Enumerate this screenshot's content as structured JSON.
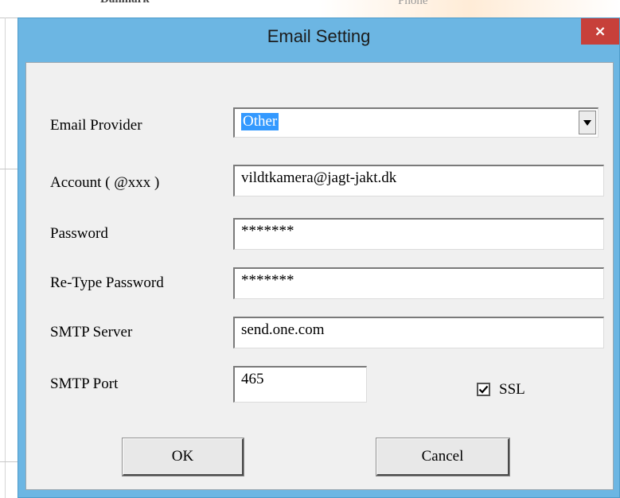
{
  "background": {
    "partial_text_1": "Danmark",
    "partial_text_2": "Phone"
  },
  "dialog": {
    "title": "Email Setting",
    "close_icon": "×",
    "accent_color": "#6cb6e3",
    "close_color": "#c7403a",
    "fields": {
      "provider": {
        "label": "Email Provider",
        "value": "Other"
      },
      "account": {
        "label": "Account ( @xxx )",
        "value": "vildtkamera@jagt-jakt.dk"
      },
      "password": {
        "label": "Password",
        "value": "*******"
      },
      "retype": {
        "label": "Re-Type Password",
        "value": "*******"
      },
      "server": {
        "label": "SMTP Server",
        "value": "send.one.com"
      },
      "port": {
        "label": "SMTP Port",
        "value": "465"
      }
    },
    "ssl": {
      "label": "SSL",
      "checked": true
    },
    "buttons": {
      "ok": "OK",
      "cancel": "Cancel"
    }
  }
}
